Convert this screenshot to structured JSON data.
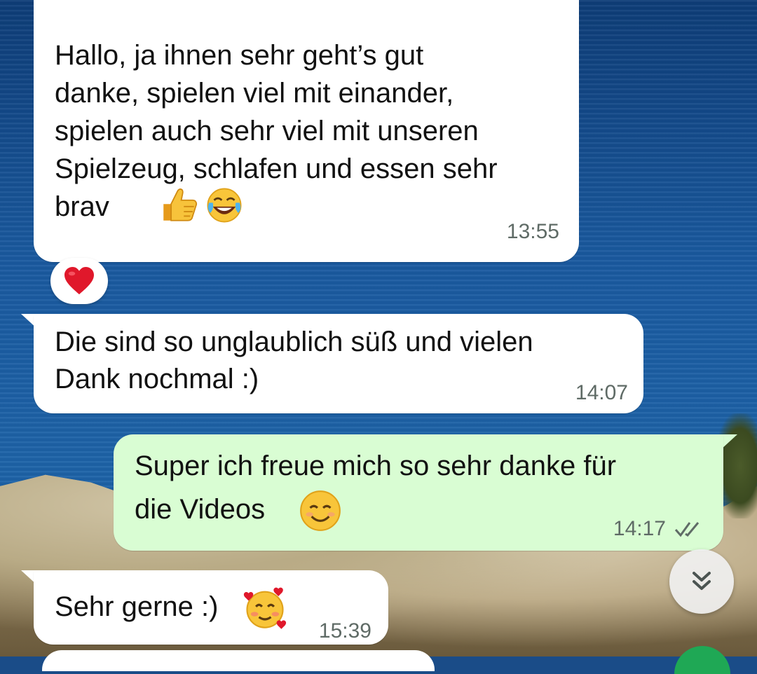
{
  "colors": {
    "incoming_bubble": "#ffffff",
    "outgoing_bubble": "#d9fdd3",
    "timestamp": "#5f6b66",
    "read_ticks": "#5f6b66",
    "reaction_heart": "#e0182b"
  },
  "chat": {
    "messages": [
      {
        "direction": "incoming",
        "text": "Hallo, ja ihnen sehr geht’s gut\ndanke, spielen viel mit einander,\nspielen auch sehr viel mit unseren\nSpielzeug, schlafen und essen sehr\nbrav",
        "emojis": [
          "thumbs-up-icon",
          "tears-of-joy-icon"
        ],
        "time": "13:55",
        "reaction": "red-heart-icon"
      },
      {
        "direction": "incoming",
        "text": "Die sind so unglaublich süß und vielen\nDank nochmal :)",
        "time": "14:07"
      },
      {
        "direction": "outgoing",
        "text": "Super ich freue mich so sehr danke für\ndie Videos",
        "emojis": [
          "smiling-face-icon"
        ],
        "time": "14:17",
        "status": "read-double-check-icon"
      },
      {
        "direction": "incoming",
        "text": "Sehr gerne :)",
        "emojis": [
          "smiling-face-with-hearts-icon"
        ],
        "time": "15:39"
      }
    ]
  },
  "controls": {
    "scroll_down_icon": "double-chevron-down-icon"
  }
}
